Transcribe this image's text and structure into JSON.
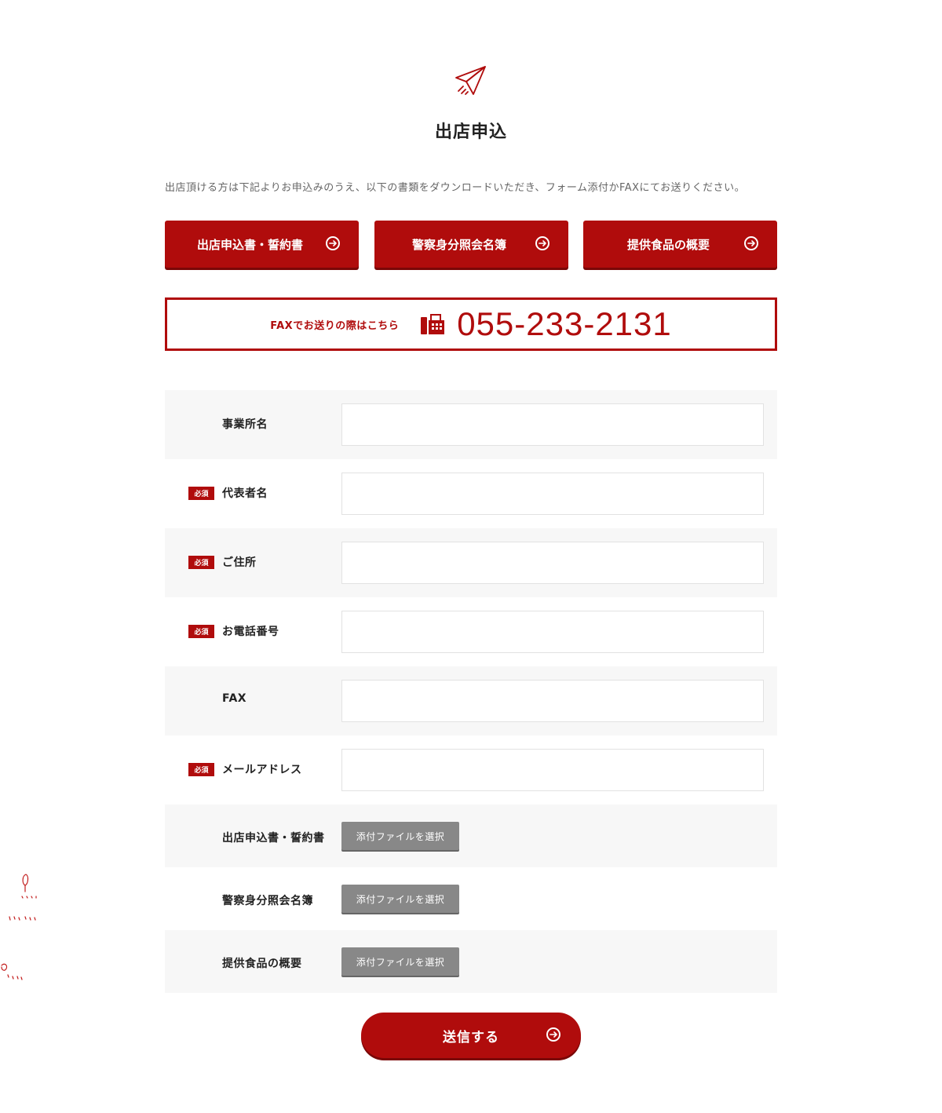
{
  "header": {
    "icon": "paper-plane-icon",
    "title": "出店申込"
  },
  "intro": "出店頂ける方は下記よりお申込みのうえ、以下の書類をダウンロードいただき、フォーム添付かFAXにてお送りください。",
  "downloads": [
    {
      "label": "出店申込書・誓約書",
      "icon": "arrow-right-circle-icon"
    },
    {
      "label": "警察身分照会名簿",
      "icon": "arrow-right-circle-icon"
    },
    {
      "label": "提供食品の概要",
      "icon": "arrow-right-circle-icon"
    }
  ],
  "fax": {
    "note": "FAXでお送りの際はこちら",
    "icon": "fax-machine-icon",
    "number": "055-233-2131"
  },
  "form": {
    "required_badge": "必須",
    "fields": [
      {
        "label": "事業所名",
        "required": false,
        "value": ""
      },
      {
        "label": "代表者名",
        "required": true,
        "value": ""
      },
      {
        "label": "ご住所",
        "required": true,
        "value": ""
      },
      {
        "label": "お電話番号",
        "required": true,
        "value": ""
      },
      {
        "label": "FAX",
        "required": false,
        "value": ""
      },
      {
        "label": "メールアドレス",
        "required": true,
        "value": ""
      }
    ],
    "attachments": [
      {
        "label": "出店申込書・誓約書",
        "button": "添付ファイルを選択"
      },
      {
        "label": "警察身分照会名簿",
        "button": "添付ファイルを選択"
      },
      {
        "label": "提供食品の概要",
        "button": "添付ファイルを選択"
      }
    ]
  },
  "submit": {
    "label": "送信する",
    "icon": "arrow-right-circle-icon"
  },
  "colors": {
    "accent": "#b00c0c",
    "row_shade": "#f7f7f7",
    "file_button": "#888888"
  }
}
